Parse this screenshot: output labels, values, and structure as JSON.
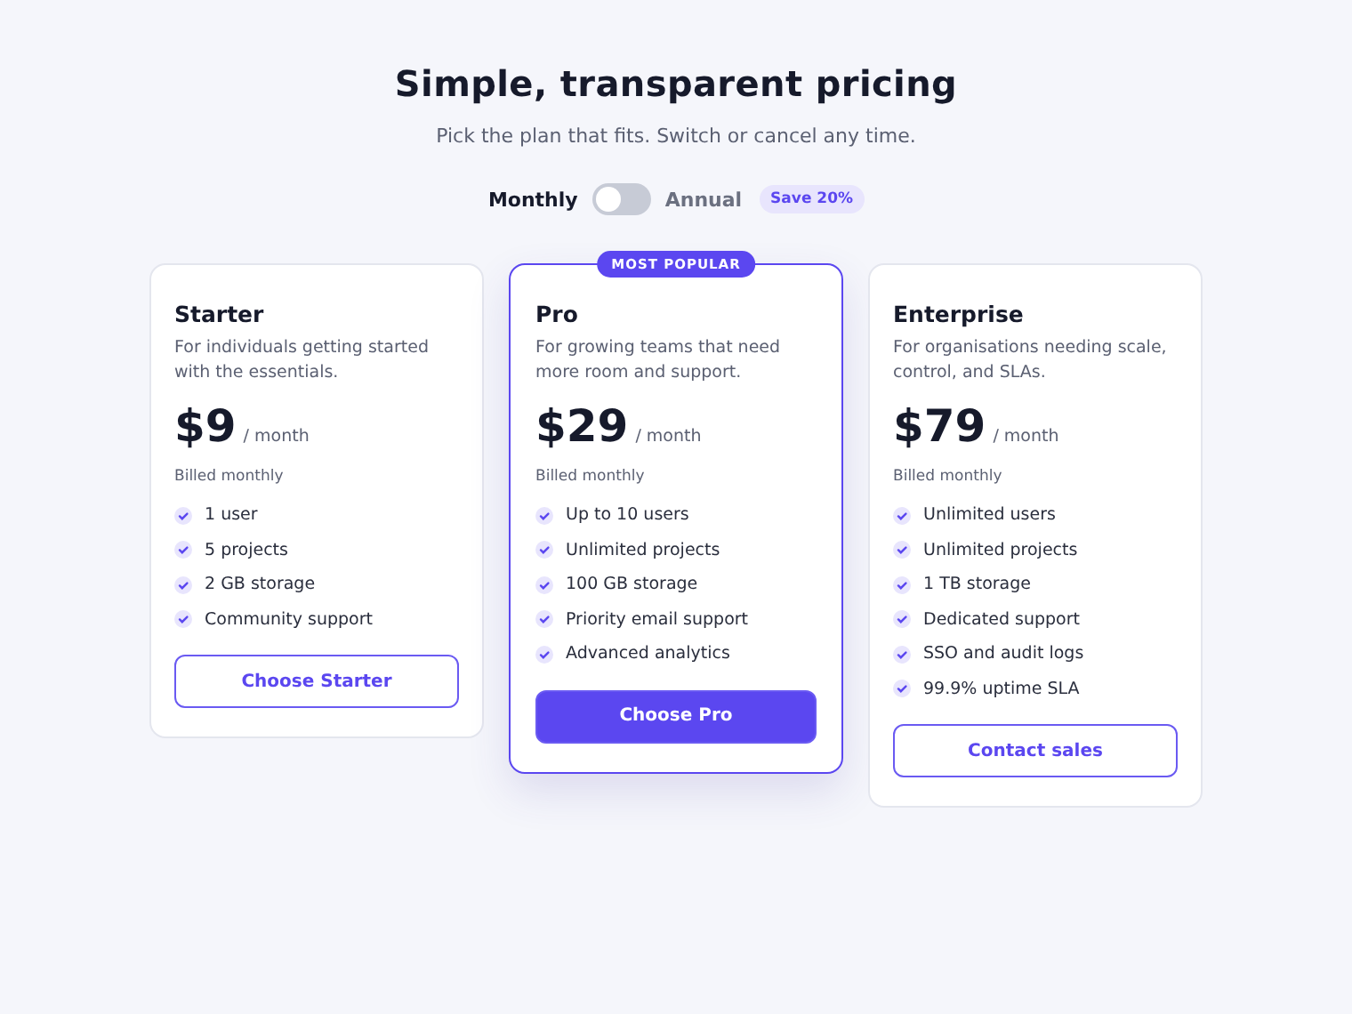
{
  "header": {
    "title": "Simple, transparent pricing",
    "subtitle": "Pick the plan that fits. Switch or cancel any time."
  },
  "billing": {
    "monthly_label": "Monthly",
    "annual_label": "Annual",
    "annual": false,
    "save_badge": "Save 20%"
  },
  "plans": [
    {
      "name": "Starter",
      "description": "For individuals getting started with the essentials.",
      "price": "$9",
      "period": "/ month",
      "billing_note": "Billed monthly",
      "features": [
        "1 user",
        "5 projects",
        "2 GB storage",
        "Community support"
      ],
      "cta": "Choose Starter",
      "featured": false
    },
    {
      "name": "Pro",
      "badge": "MOST POPULAR",
      "description": "For growing teams that need more room and support.",
      "price": "$29",
      "period": "/ month",
      "billing_note": "Billed monthly",
      "features": [
        "Up to 10 users",
        "Unlimited projects",
        "100 GB storage",
        "Priority email support",
        "Advanced analytics"
      ],
      "cta": "Choose Pro",
      "featured": true
    },
    {
      "name": "Enterprise",
      "description": "For organisations needing scale, control, and SLAs.",
      "price": "$79",
      "period": "/ month",
      "billing_note": "Billed monthly",
      "features": [
        "Unlimited users",
        "Unlimited projects",
        "1 TB storage",
        "Dedicated support",
        "SSO and audit logs",
        "99.9% uptime SLA"
      ],
      "cta": "Contact sales",
      "featured": false
    }
  ]
}
